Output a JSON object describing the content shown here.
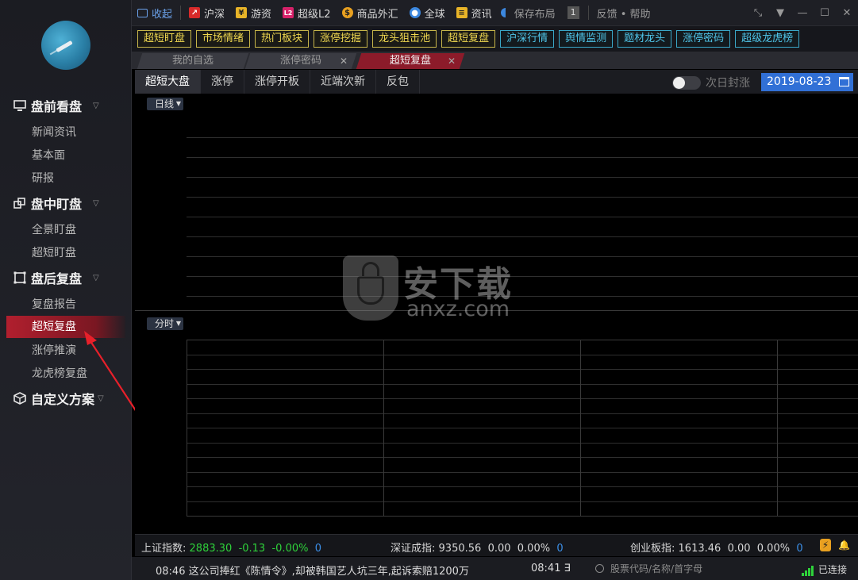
{
  "sidebar": {
    "sections": [
      {
        "title": "盘前看盘",
        "items": [
          "新闻资讯",
          "基本面",
          "研报"
        ]
      },
      {
        "title": "盘中盯盘",
        "items": [
          "全景盯盘",
          "超短盯盘"
        ]
      },
      {
        "title": "盘后复盘",
        "items": [
          "复盘报告",
          "超短复盘",
          "涨停推演",
          "龙虎榜复盘"
        ]
      },
      {
        "title": "自定义方案",
        "items": []
      }
    ],
    "active_item": "超短复盘"
  },
  "topbar": {
    "collapse": "收起",
    "items": [
      "沪深",
      "游资",
      "超级L2",
      "商品外汇",
      "全球",
      "资讯"
    ],
    "save_layout": "保存布局",
    "layout_num": "1",
    "feedback": "反馈 • 帮助"
  },
  "quick_buttons": {
    "yellow": [
      "超短盯盘",
      "市场情绪",
      "热门板块",
      "涨停挖掘",
      "龙头狙击池",
      "超短复盘"
    ],
    "cyan": [
      "沪深行情",
      "舆情监测",
      "题材龙头",
      "涨停密码",
      "超级龙虎榜"
    ]
  },
  "tabs": [
    {
      "label": "我的自选"
    },
    {
      "label": "涨停密码"
    },
    {
      "label": "超短复盘"
    }
  ],
  "subtabs": [
    "超短大盘",
    "涨停",
    "涨停开板",
    "近端次新",
    "反包"
  ],
  "toggle_label": "次日封涨",
  "date": "2019-08-23",
  "charts": {
    "top_dropdown": "日线",
    "bottom_dropdown": "分时"
  },
  "watermark": {
    "cn": "安下载",
    "en": "anxz.com"
  },
  "status": {
    "sh": {
      "name": "上证指数:",
      "value": "2883.30",
      "change": "-0.13",
      "pct": "-0.00%",
      "count": "0"
    },
    "sz": {
      "name": "深证成指:",
      "value": "9350.56",
      "change": "0.00",
      "pct": "0.00%",
      "count": "0"
    },
    "cy": {
      "name": "创业板指:",
      "value": "1613.46",
      "change": "0.00",
      "pct": "0.00%",
      "count": "0"
    }
  },
  "news": {
    "item1": "08:46 这公司捧红《陈情令》,却被韩国艺人坑三年,起诉索赔1200万",
    "item2": "08:41 ∃",
    "search_placeholder": "股票代码/名称/首字母",
    "connection": "已连接"
  }
}
